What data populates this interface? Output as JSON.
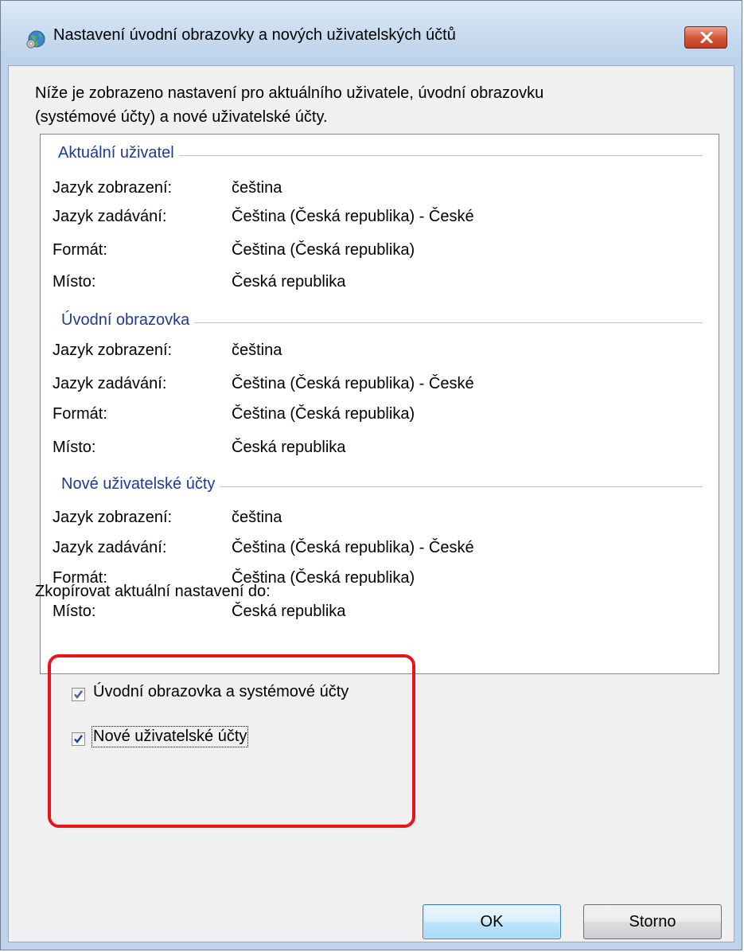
{
  "window": {
    "title": "Nastavení úvodní obrazovky a nových uživatelských účtů",
    "icon": "globe-settings-icon",
    "close_icon": "close-icon"
  },
  "intro": {
    "line1": "Níže je zobrazeno nastavení pro aktuálního uživatele, úvodní obrazovku",
    "line2": "(systémové účty) a nové uživatelské účty."
  },
  "sections": [
    {
      "heading": "Aktuální uživatel",
      "rows": [
        {
          "key": "Jazyk zobrazení:",
          "value": "čeština"
        },
        {
          "key": "Jazyk zadávání:",
          "value": "Čeština (Česká republika) - České"
        },
        {
          "key": "Formát:",
          "value": "Čeština (Česká republika)"
        },
        {
          "key": "Místo:",
          "value": "Česká republika"
        }
      ]
    },
    {
      "heading": "Úvodní obrazovka",
      "rows": [
        {
          "key": "Jazyk zobrazení:",
          "value": "čeština"
        },
        {
          "key": "Jazyk zadávání:",
          "value": "Čeština (Česká republika) - České"
        },
        {
          "key": "Formát:",
          "value": "Čeština (Česká republika)"
        },
        {
          "key": "Místo:",
          "value": "Česká republika"
        }
      ]
    },
    {
      "heading": "Nové uživatelské účty",
      "rows": [
        {
          "key": "Jazyk zobrazení:",
          "value": "čeština"
        },
        {
          "key": "Jazyk zadávání:",
          "value": "Čeština (Česká republika) - České"
        },
        {
          "key": "Formát:",
          "value": "Čeština (Česká republika)"
        },
        {
          "key": "Místo:",
          "value": "Česká republika"
        }
      ]
    }
  ],
  "copy": {
    "label": "Zkopírovat aktuální nastavení do:",
    "checkboxes": [
      {
        "label": "Úvodní obrazovka a systémové účty",
        "checked": true
      },
      {
        "label": "Nové uživatelské účty",
        "checked": true
      }
    ]
  },
  "buttons": {
    "ok": "OK",
    "cancel": "Storno"
  },
  "colors": {
    "section_heading": "#1e3b93",
    "highlight": "#e8141b"
  }
}
